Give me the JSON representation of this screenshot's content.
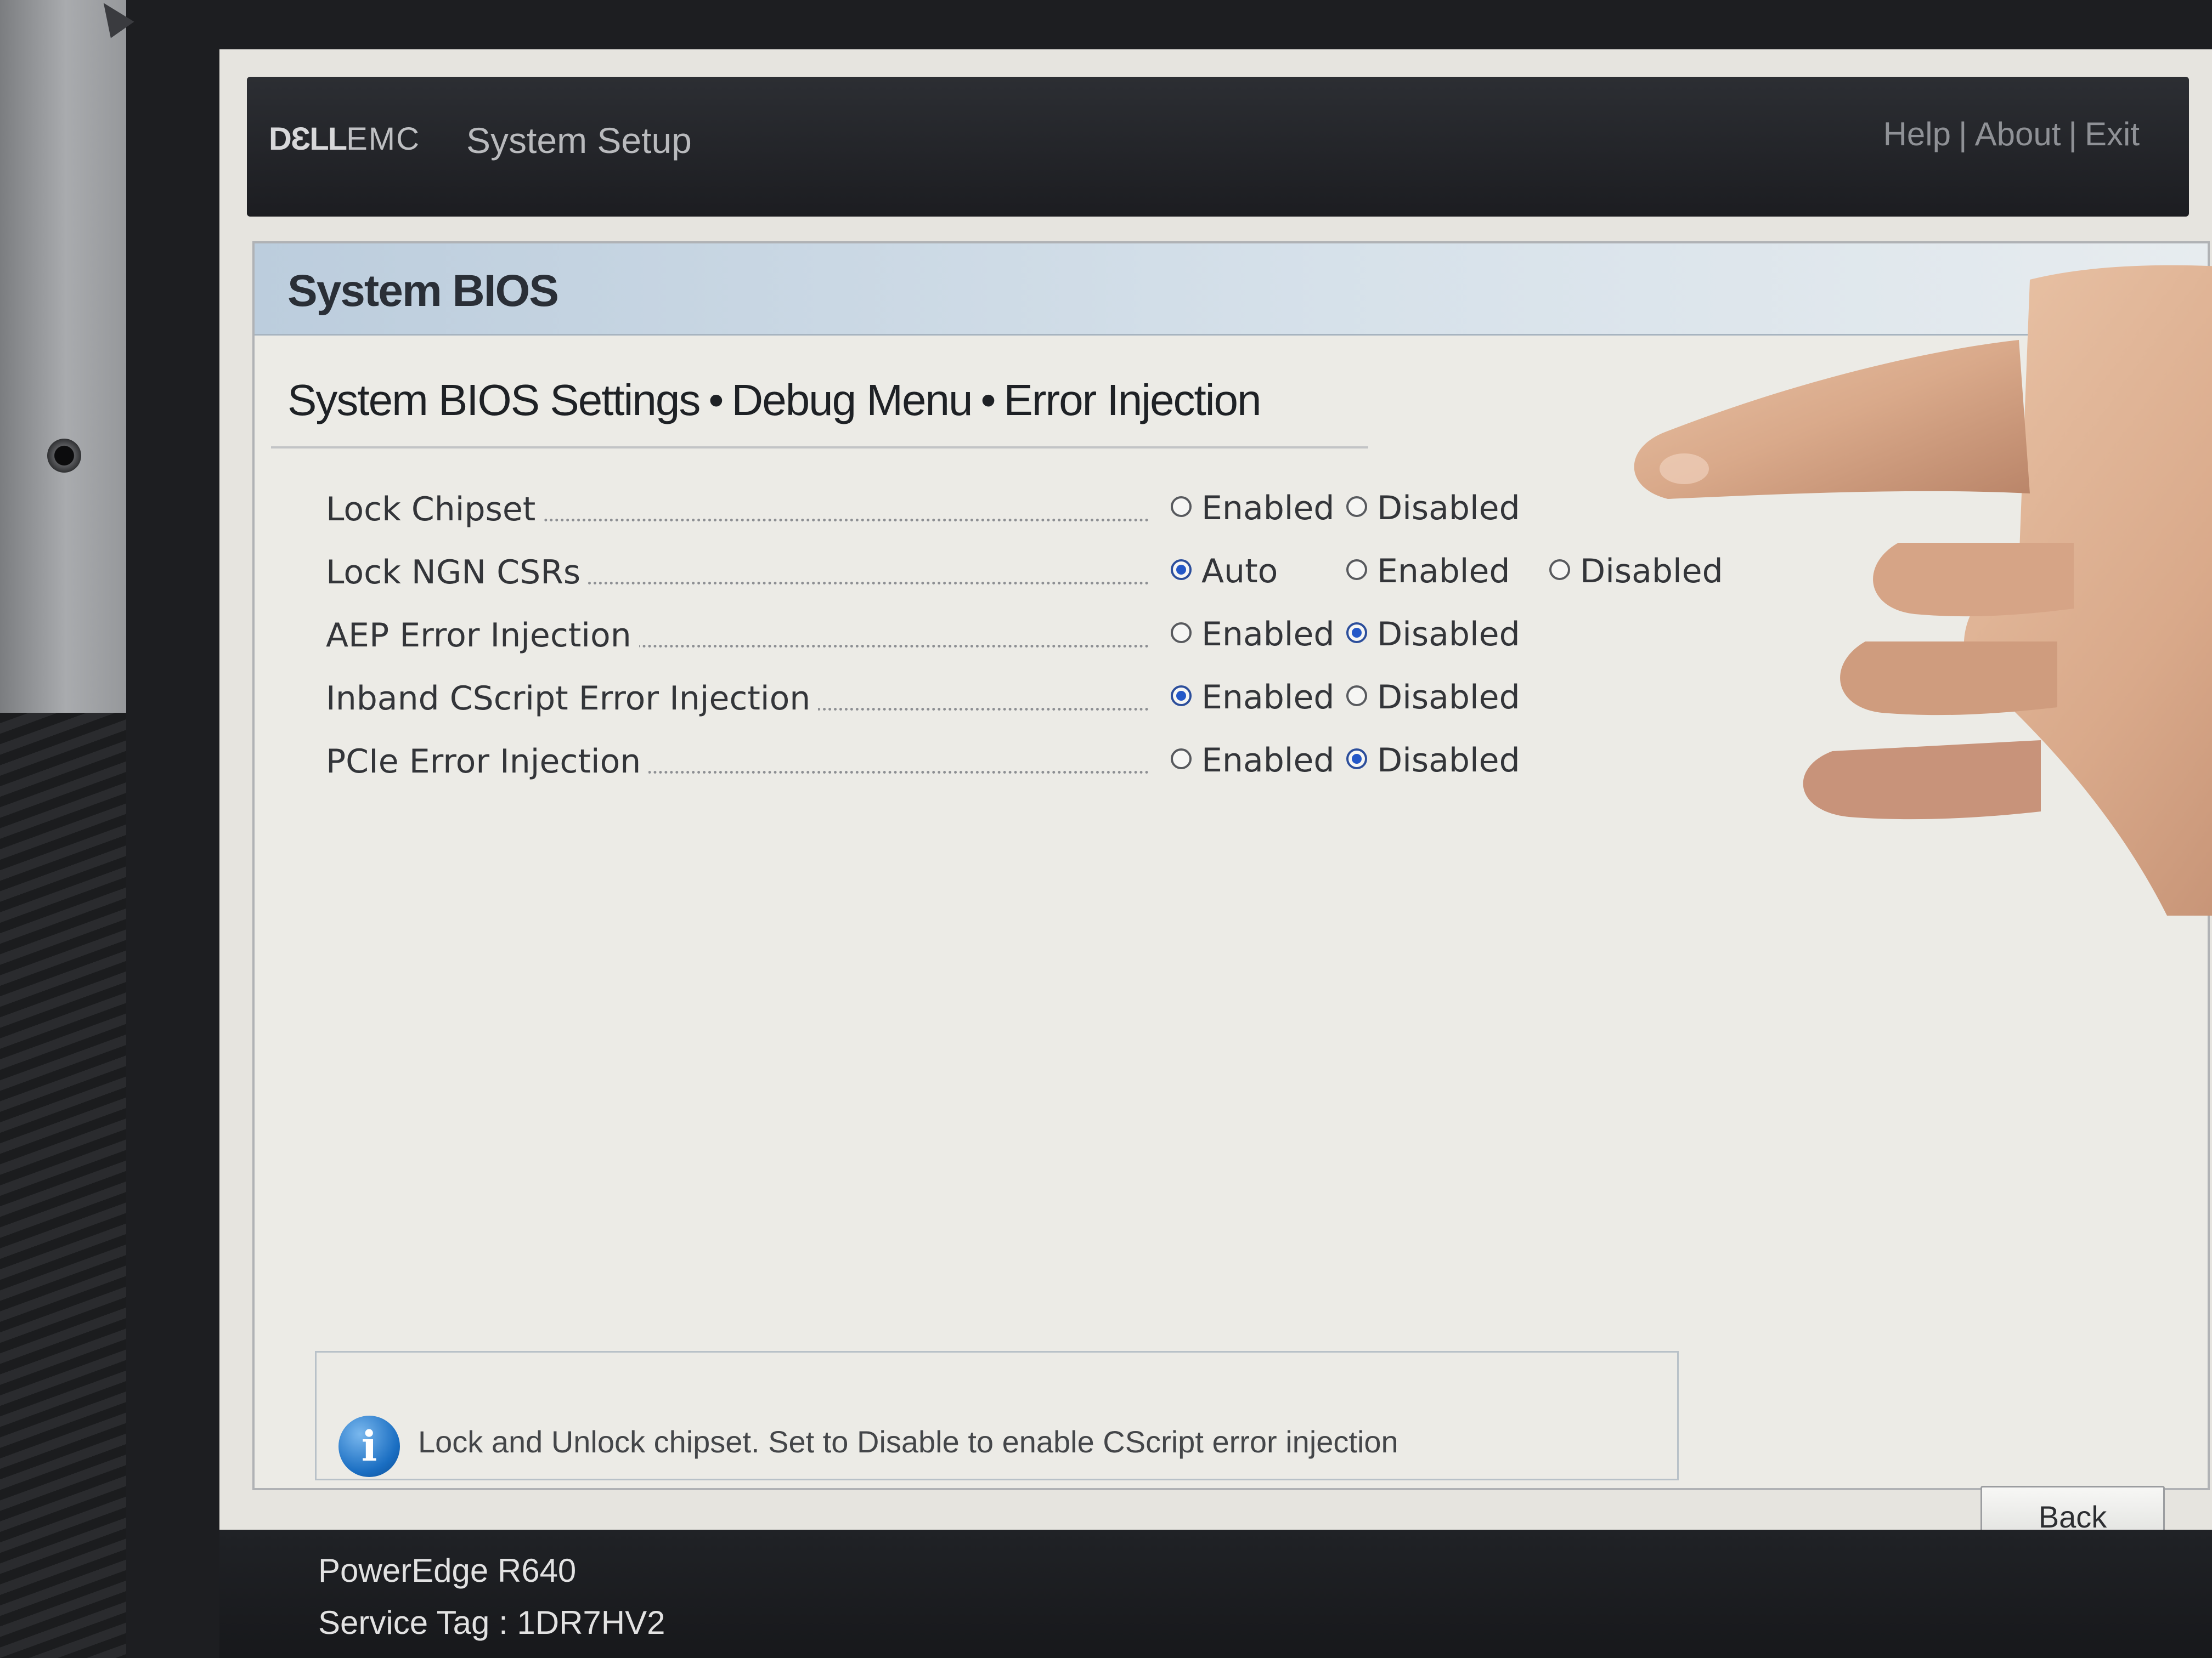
{
  "header": {
    "logo_bold": "DƐLL",
    "logo_light": "EMC",
    "app_title": "System Setup",
    "links": [
      "Help",
      "About",
      "Exit"
    ],
    "link_separator": "|"
  },
  "panel": {
    "title": "System BIOS",
    "breadcrumb": [
      "System BIOS Settings",
      "Debug Menu",
      "Error Injection"
    ],
    "breadcrumb_separator": "•"
  },
  "settings": [
    {
      "label": "Lock Chipset",
      "options": [
        {
          "label": "Enabled",
          "selected": false
        },
        {
          "label": "Disabled",
          "selected": false
        }
      ]
    },
    {
      "label": "Lock NGN CSRs",
      "options": [
        {
          "label": "Auto",
          "selected": true
        },
        {
          "label": "Enabled",
          "selected": false
        },
        {
          "label": "Disabled",
          "selected": false
        }
      ]
    },
    {
      "label": "AEP Error Injection",
      "options": [
        {
          "label": "Enabled",
          "selected": false
        },
        {
          "label": "Disabled",
          "selected": true
        }
      ]
    },
    {
      "label": "Inband CScript Error Injection",
      "options": [
        {
          "label": "Enabled",
          "selected": true
        },
        {
          "label": "Disabled",
          "selected": false
        }
      ]
    },
    {
      "label": "PCIe Error Injection",
      "options": [
        {
          "label": "Enabled",
          "selected": false
        },
        {
          "label": "Disabled",
          "selected": true
        }
      ]
    }
  ],
  "info": {
    "icon": "info-icon",
    "text": "Lock and Unlock chipset.  Set to Disable to enable CScript error injection"
  },
  "footer": {
    "model": "PowerEdge R640",
    "service_tag": "Service Tag : 1DR7HV2",
    "back_label": "Back"
  },
  "colors": {
    "header_bg": "#1c1d21",
    "title_bar": "#bccddd",
    "radio_selected": "#2458c8",
    "info_icon": "#1a6ec2"
  }
}
